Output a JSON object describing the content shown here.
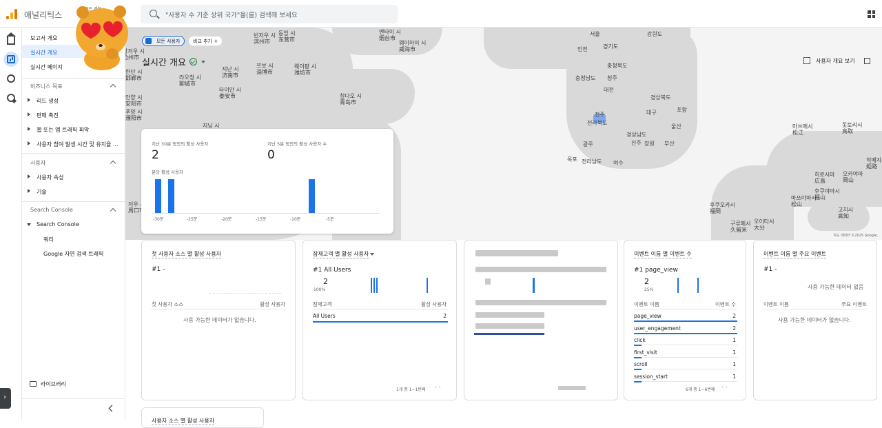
{
  "app": {
    "name": "애널리틱스"
  },
  "property": {
    "small": "모든 계정 > ...",
    "main": ""
  },
  "search": {
    "placeholder": "\"사용자 수 기준 상위 국가\"을(를) 검색해 보세요"
  },
  "nav": {
    "top": [
      "보고서 개요",
      "실시간 개요",
      "실시간 페이지"
    ],
    "sections": [
      {
        "title": "비즈니스 목표",
        "items": [
          "리드 생성",
          "판매 촉진",
          "웹 또는 앱 트래픽 파악",
          "사용자 참여 발생 시간 및 유지율 ..."
        ]
      },
      {
        "title": "사용자",
        "items": [
          "사용자 속성",
          "기술"
        ]
      },
      {
        "title": "Search Console",
        "items": [
          "Search Console"
        ],
        "subitems": [
          "쿼리",
          "Google 자연 검색 트래픽"
        ]
      }
    ],
    "library": "라이브러리"
  },
  "filters": {
    "all_users": "모든 사용자",
    "add_compare": "비교 추가"
  },
  "page_title": "실시간 개요",
  "map_actions": {
    "view_users": "사용자 개요 보기"
  },
  "map": {
    "credit": "지도 데이터 ©2025 Google,",
    "labels": {
      "seoul": "서울",
      "incheon": "인천",
      "gyeonggi": "경기도",
      "gangwon": "강원도",
      "chungbuk": "충청북도",
      "chungnam": "충청남도",
      "cheongju": "청주",
      "daejeon": "대전",
      "gyeongbuk": "경상북도",
      "jeonju": "전주",
      "daegu": "대구",
      "pohang": "포항",
      "jeonbuk": "전라북도",
      "ulsan": "울산",
      "gyeongnam": "경상남도",
      "changwon": "창원",
      "busan": "부산",
      "jinju": "진주",
      "gwangju": "광주",
      "mokpo": "목포",
      "jeonnam": "전라남도",
      "yeosu": "여수",
      "dalian": "대련 시",
      "yantai": "옌타이 시\n烟台市",
      "weihai": "웨이하이 시\n威海市",
      "dongying": "동잉 시\n东营市",
      "binzhou": "빈저우 시\n滨州市",
      "weifang": "웨이팡 시\n潍坊市",
      "zibo": "쯔보 시\n淄博市",
      "jinan": "지난 시\n济南市",
      "rizhao": "르자오 시\n日照市",
      "taian": "타이안 시\n泰安市",
      "liaocheng": "랴오청 시\n聊城市",
      "qingdao": "칭다오 시\n青岛市",
      "jining": "지닝 시",
      "cangzhou": "창저우 시\n沧州市",
      "dezhou": "더저우 시\n德州市",
      "handan": "한단 시\n邯郸市",
      "anyang": "안양 시\n安阳市",
      "puyang": "푸양 시\n濮阳市",
      "xuzhou": "저우 시\n周口市",
      "fukuoka": "후쿠오카시\n福岡",
      "kitakyushu": "기타큐슈시\n北九州市",
      "okayama": "오카야마\n岡山",
      "kochi": "고치시\n高知",
      "hiroshima": "히로시마\n広島",
      "oita": "오이타시\n大分",
      "kurume": "구루메시\n久留米",
      "shimane": "마쓰에시\n松江",
      "tottori": "돗토리시\n鳥取",
      "himeji": "히메지시\n姫路",
      "kagawa": "가가와",
      "matsuyama": "마쓰야마시\n松山",
      "fukuyama": "후쿠야마시\n福山"
    }
  },
  "realtime": {
    "active30_label": "지난 30분 동안의 활성 사용자",
    "active30_value": "2",
    "active5_label": "지난 5분 동안의 활성 사용자 수",
    "active5_value": "0",
    "per_minute_label": "분당 활성 사용자",
    "axis": [
      "-30분",
      "-25분",
      "-20분",
      "-15분",
      "-10분",
      "-5분"
    ]
  },
  "chart_data": {
    "type": "bar",
    "title": "분당 활성 사용자",
    "x": [
      "-30분",
      "-25분",
      "-20분",
      "-15분",
      "-10분",
      "-5분"
    ],
    "values_by_minute_ago": [
      {
        "minute": 30,
        "value": 1
      },
      {
        "minute": 28,
        "value": 1
      },
      {
        "minute": 7,
        "value": 1
      }
    ]
  },
  "cards": {
    "source": {
      "title": "첫 사용자 소스 별 활성 사용자",
      "rank": "#1  -",
      "col1": "첫 사용자 소스",
      "col2": "활성 사용자",
      "nodata": "사용 가능한 데이터가 없습니다."
    },
    "audience": {
      "title": "잠재고객 별 활성 사용자",
      "rank": "#1  All Users",
      "value": "2",
      "pct": "100%",
      "col1": "잠재고객",
      "col2": "활성 사용자",
      "rows": [
        {
          "name": "All Users",
          "value": "2"
        }
      ],
      "pager": "1개 중 1~1번째"
    },
    "events": {
      "title": "이벤트 이름 별 이벤트 수",
      "rank": "#1  page_view",
      "value": "2",
      "pct": "25%",
      "col1": "이벤트 이름",
      "col2": "이벤트 수",
      "rows": [
        {
          "name": "page_view",
          "value": "2"
        },
        {
          "name": "user_engagement",
          "value": "2"
        },
        {
          "name": "click",
          "value": "1"
        },
        {
          "name": "first_visit",
          "value": "1"
        },
        {
          "name": "scroll",
          "value": "1"
        },
        {
          "name": "session_start",
          "value": "1"
        }
      ],
      "pager": "6개 중 1~6번째"
    },
    "key_events": {
      "title": "이벤트 이름 별 주요 이벤트",
      "rank": "#1  -",
      "empty": "사용 가능한 데이터 없음",
      "col1": "이벤트 이름",
      "col2": "주요 이벤트",
      "nodata": "사용 가능한 데이터가 없습니다."
    },
    "bottom": {
      "title": "사용자 소스 별 활성 사용자"
    }
  }
}
